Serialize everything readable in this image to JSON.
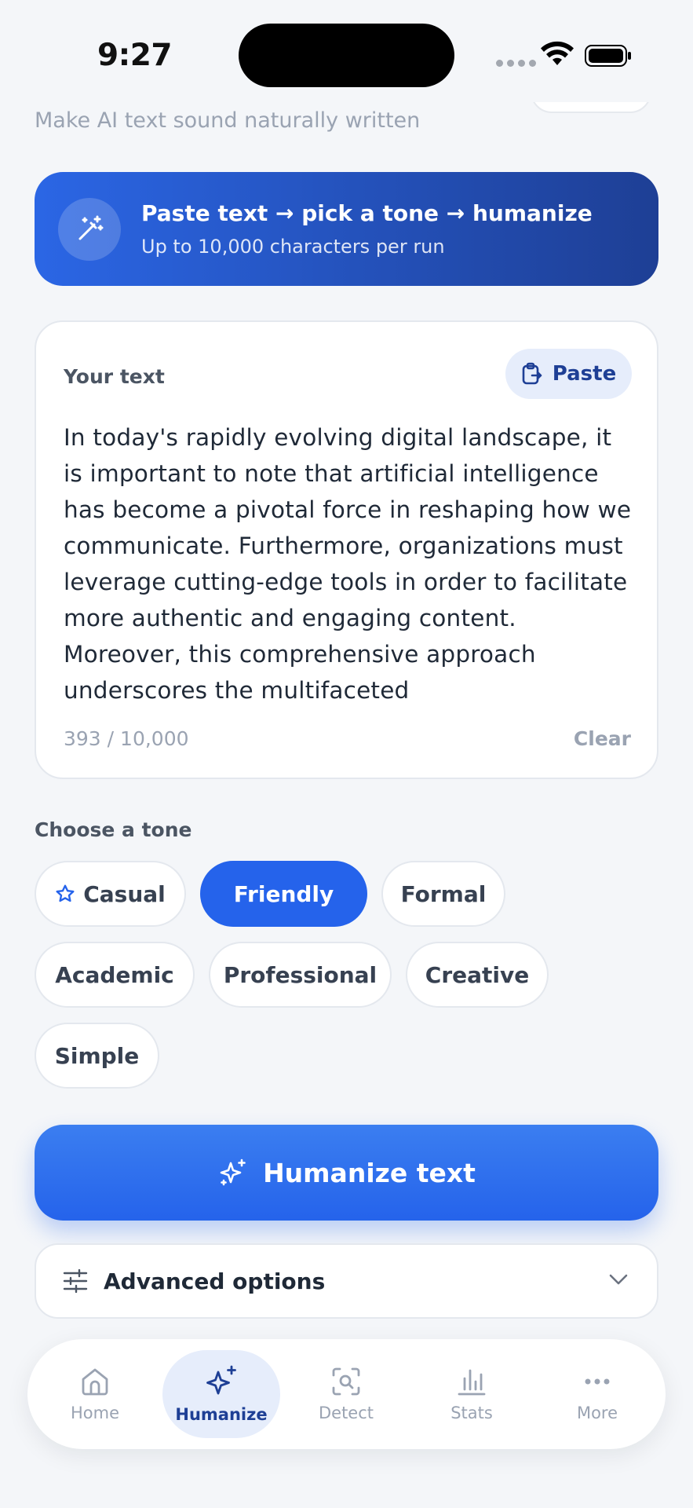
{
  "status_bar": {
    "time": "9:27"
  },
  "header": {
    "subtitle": "Make AI text sound naturally written"
  },
  "banner": {
    "title": "Paste text → pick a tone → humanize",
    "subtitle": "Up to 10,000 characters per run",
    "icon": "magic-wand-icon"
  },
  "input_card": {
    "label": "Your text",
    "paste_label": "Paste",
    "text": "In today's rapidly evolving digital landscape, it is important to note that artificial intelligence has become a pivotal force in reshaping how we communicate. Furthermore, organizations must leverage cutting-edge tools in order to facilitate more authentic and engaging content. Moreover, this comprehensive approach underscores the multifaceted",
    "char_count": "393 / 10,000",
    "clear_label": "Clear"
  },
  "tone": {
    "label": "Choose a tone",
    "options": [
      "Casual",
      "Friendly",
      "Formal",
      "Academic",
      "Professional",
      "Creative",
      "Simple"
    ],
    "selected": "Friendly"
  },
  "primary_action": {
    "label": "Humanize text",
    "icon": "sparkles-icon"
  },
  "advanced": {
    "label": "Advanced options"
  },
  "nav": {
    "items": [
      {
        "label": "Home",
        "icon": "home-icon"
      },
      {
        "label": "Humanize",
        "icon": "sparkles-icon"
      },
      {
        "label": "Detect",
        "icon": "scan-search-icon"
      },
      {
        "label": "Stats",
        "icon": "bar-chart-icon"
      },
      {
        "label": "More",
        "icon": "more-dots-icon"
      }
    ],
    "active": "Humanize"
  },
  "colors": {
    "accent": "#2563eb",
    "accent_dark": "#1e3f95",
    "background": "#f4f6f9",
    "muted": "#9aa3b2"
  }
}
